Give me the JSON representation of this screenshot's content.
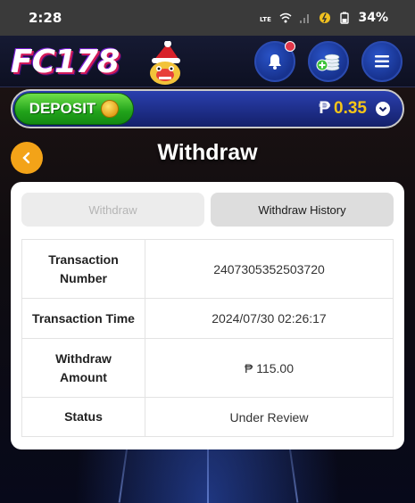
{
  "statusbar": {
    "time": "2:28",
    "battery": "34%"
  },
  "header": {
    "logo": "FC178"
  },
  "deposit": {
    "label": "DEPOSIT",
    "currency": "₱",
    "amount": "0.35"
  },
  "page": {
    "title": "Withdraw"
  },
  "tabs": {
    "withdraw": "Withdraw",
    "history": "Withdraw History"
  },
  "details": {
    "rows": [
      {
        "label_line1": "Transaction",
        "label_line2": "Number",
        "value": "2407305352503720"
      },
      {
        "label": "Transaction Time",
        "value": "2024/07/30 02:26:17"
      },
      {
        "label_line1": "Withdraw",
        "label_line2": "Amount",
        "value": "₱ 115.00"
      },
      {
        "label": "Status",
        "value": "Under Review"
      }
    ]
  },
  "colors": {
    "accent_gold": "#f5c518",
    "deposit_green": "#21a21a",
    "header_blue": "#17328e",
    "back_orange": "#f3a318"
  }
}
